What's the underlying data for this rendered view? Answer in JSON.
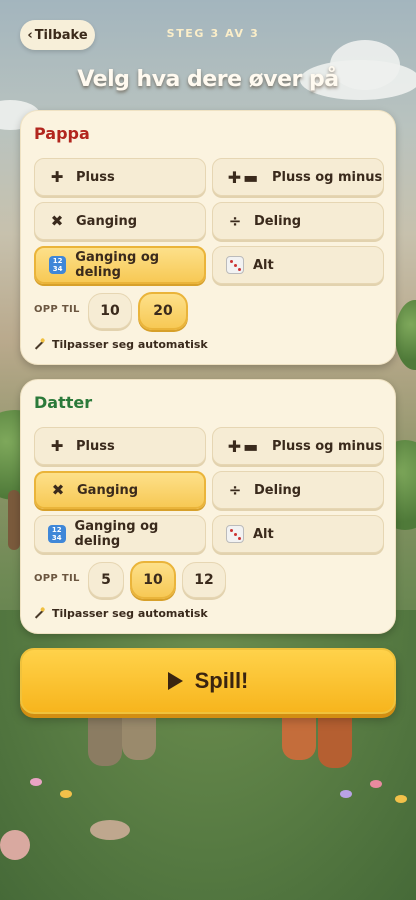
{
  "header": {
    "back_label": "Tilbake",
    "back_icon": "chevron-left-icon",
    "step": "STEG 3 AV 3",
    "title": "Velg hva dere øver på"
  },
  "players": [
    {
      "name": "Pappa",
      "name_color": "#b2261e",
      "options": [
        {
          "label": "Pluss",
          "icon": "plus-icon",
          "selected": false
        },
        {
          "label": "Pluss og minus",
          "icon": "plus-minus-icon",
          "selected": false
        },
        {
          "label": "Ganging",
          "icon": "multiply-icon",
          "selected": false
        },
        {
          "label": "Deling",
          "icon": "divide-icon",
          "selected": false
        },
        {
          "label": "Ganging og deling",
          "icon": "number-grid-icon",
          "selected": true
        },
        {
          "label": "Alt",
          "icon": "dice-icon",
          "selected": false
        }
      ],
      "opp_til_label": "OPP TIL",
      "limits": [
        {
          "value": "10",
          "selected": false
        },
        {
          "value": "20",
          "selected": true
        }
      ],
      "auto_label": "Tilpasser seg automatisk"
    },
    {
      "name": "Datter",
      "name_color": "#2b7a3a",
      "options": [
        {
          "label": "Pluss",
          "icon": "plus-icon",
          "selected": false
        },
        {
          "label": "Pluss og minus",
          "icon": "plus-minus-icon",
          "selected": false
        },
        {
          "label": "Ganging",
          "icon": "multiply-icon",
          "selected": true
        },
        {
          "label": "Deling",
          "icon": "divide-icon",
          "selected": false
        },
        {
          "label": "Ganging og deling",
          "icon": "number-grid-icon",
          "selected": false
        },
        {
          "label": "Alt",
          "icon": "dice-icon",
          "selected": false
        }
      ],
      "opp_til_label": "OPP TIL",
      "limits": [
        {
          "value": "5",
          "selected": false
        },
        {
          "value": "10",
          "selected": true
        },
        {
          "value": "12",
          "selected": false
        }
      ],
      "auto_label": "Tilpasser seg automatisk"
    }
  ],
  "play_button": {
    "label": "Spill!",
    "icon": "play-icon"
  },
  "colors": {
    "accent": "#f7c955",
    "card_bg": "#fbf3df"
  }
}
